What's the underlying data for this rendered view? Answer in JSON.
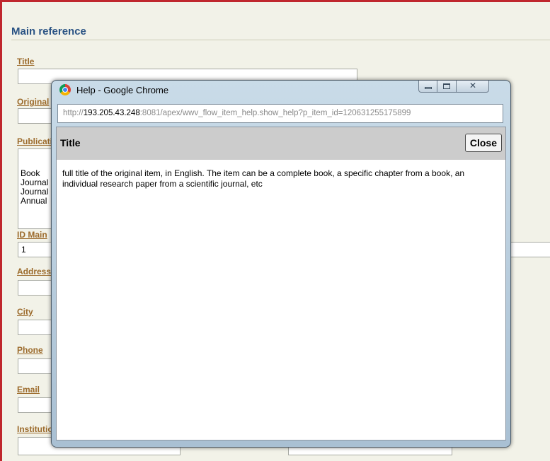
{
  "main_form": {
    "section_title": "Main reference",
    "fields": {
      "title": {
        "label": "Title",
        "value": ""
      },
      "original": {
        "label": "Original",
        "value": ""
      },
      "publication": {
        "label": "Publication type",
        "options": [
          "Book",
          "Journal",
          "Journal",
          "Annual"
        ]
      },
      "id_main": {
        "label": "ID Main",
        "value": "1"
      },
      "address": {
        "label": "Address",
        "value": ""
      },
      "city": {
        "label": "City",
        "value": ""
      },
      "phone": {
        "label": "Phone",
        "value": ""
      },
      "email": {
        "label": "Email",
        "value": ""
      },
      "institution": {
        "label": "Institution",
        "value": ""
      }
    }
  },
  "popup": {
    "window_title": "Help - Google Chrome",
    "url_prefix": "http://",
    "url_host": "193.205.43.248",
    "url_rest": ":8081/apex/wwv_flow_item_help.show_help?p_item_id=120631255175899",
    "help_title": "Title",
    "close_label": "Close",
    "help_text": "full title of the original item, in English. The item can be a complete book, a specific chapter from a book, an individual research paper from a scientific journal, etc"
  }
}
